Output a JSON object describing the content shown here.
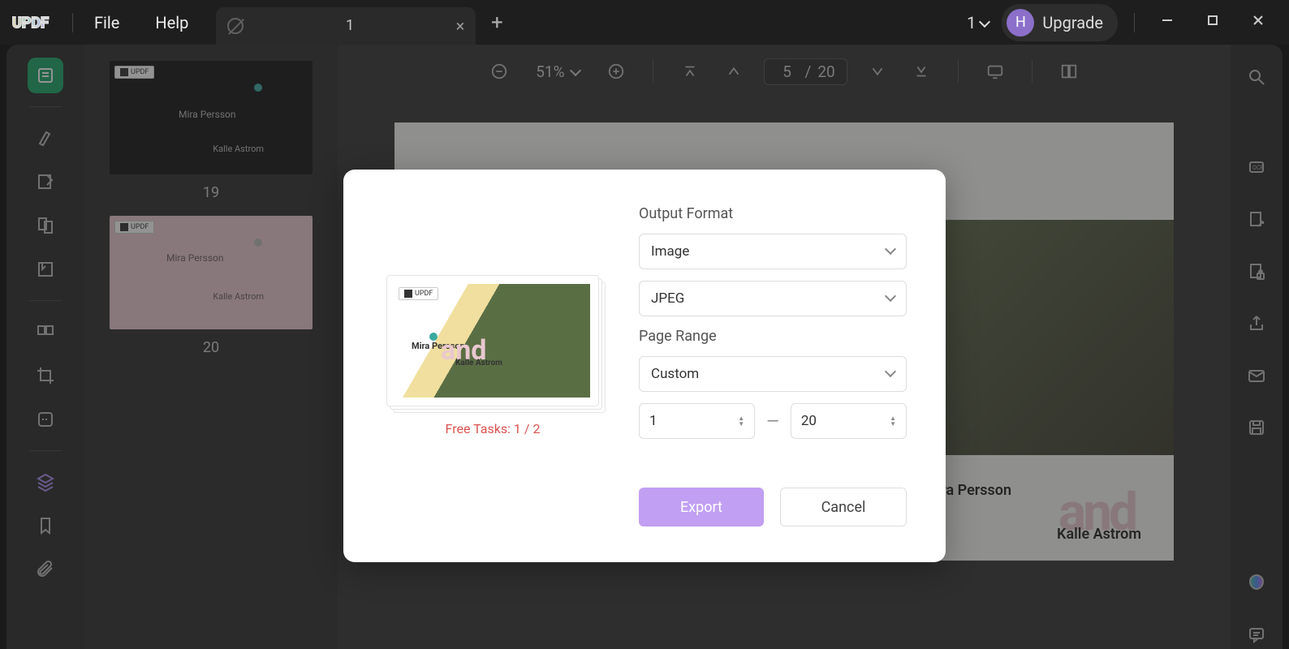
{
  "app": {
    "logo_text": "UPDF",
    "menu": {
      "file": "File",
      "help": "Help"
    }
  },
  "tab": {
    "title": "1"
  },
  "titlebar": {
    "counter": "1",
    "avatar_letter": "H",
    "upgrade": "Upgrade"
  },
  "toolbar": {
    "zoom": "51%",
    "page_current": "5",
    "page_total": "20"
  },
  "thumbs": {
    "badge": "UPDF",
    "name_a": "Mira\nPersson",
    "name_b": "Kalle\nAstrom",
    "num19": "19",
    "num20": "20"
  },
  "page": {
    "and": "and",
    "name_a": "Mira\nPersson",
    "name_b": "Kalle\nAstrom"
  },
  "modal": {
    "preview_badge": "UPDF",
    "preview_name_a": "Mira\nPersson",
    "preview_and": "and",
    "preview_name_b": "Kalle\nAstrom",
    "free_tasks": "Free Tasks: 1 / 2",
    "output_format_label": "Output Format",
    "format_value": "Image",
    "type_value": "JPEG",
    "page_range_label": "Page Range",
    "range_value": "Custom",
    "range_from": "1",
    "range_to": "20",
    "export": "Export",
    "cancel": "Cancel"
  }
}
